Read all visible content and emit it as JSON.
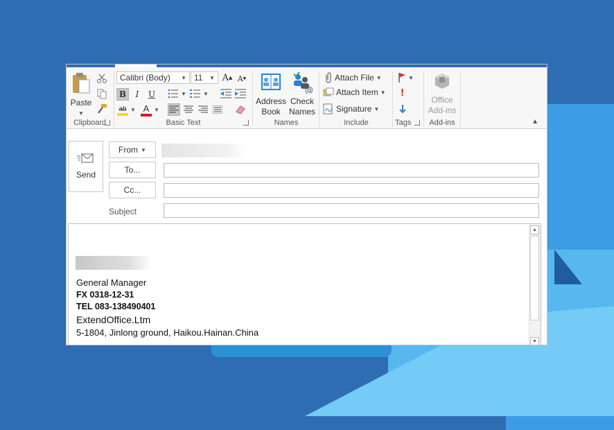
{
  "colors": {
    "accent": "#2f6db3",
    "background": "#2f6db3",
    "flag_red": "#d9363e",
    "importance_red": "#e02020",
    "low_blue": "#2c7fd3",
    "font_red": "#d61b1b",
    "highlight_yellow": "#f5e000"
  },
  "ribbon": {
    "clipboard": {
      "label": "Clipboard",
      "paste_label": "Paste",
      "icons": [
        "clipboard-icon",
        "cut-icon",
        "copy-icon",
        "format-painter-icon"
      ]
    },
    "basic_text": {
      "label": "Basic Text",
      "font_name": "Calibri (Body)",
      "font_size": "11",
      "grow_font": "A",
      "shrink_font": "A",
      "bold": "B",
      "italic": "I",
      "underline": "U",
      "highlight_glyph": "ab",
      "font_color_glyph": "A"
    },
    "names": {
      "label": "Names",
      "address_book_line1": "Address",
      "address_book_line2": "Book",
      "check_names_line1": "Check",
      "check_names_line2": "Names"
    },
    "include": {
      "label": "Include",
      "attach_file": "Attach File",
      "attach_item": "Attach Item",
      "signature": "Signature"
    },
    "tags": {
      "label": "Tags",
      "importance_high": "!"
    },
    "addins": {
      "label": "Add-ins",
      "office_line1": "Office",
      "office_line2": "Add-ins"
    }
  },
  "compose": {
    "send_label": "Send",
    "from_label": "From",
    "to_label": "To...",
    "cc_label": "Cc...",
    "subject_label": "Subject"
  },
  "signature": {
    "title": "General Manager",
    "fax": "FX 0318-12-31",
    "tel": "TEL 083-138490401",
    "company": "ExtendOffice.Ltm",
    "address": "5-1804, Jinlong ground, Haikou.Hainan.China"
  }
}
